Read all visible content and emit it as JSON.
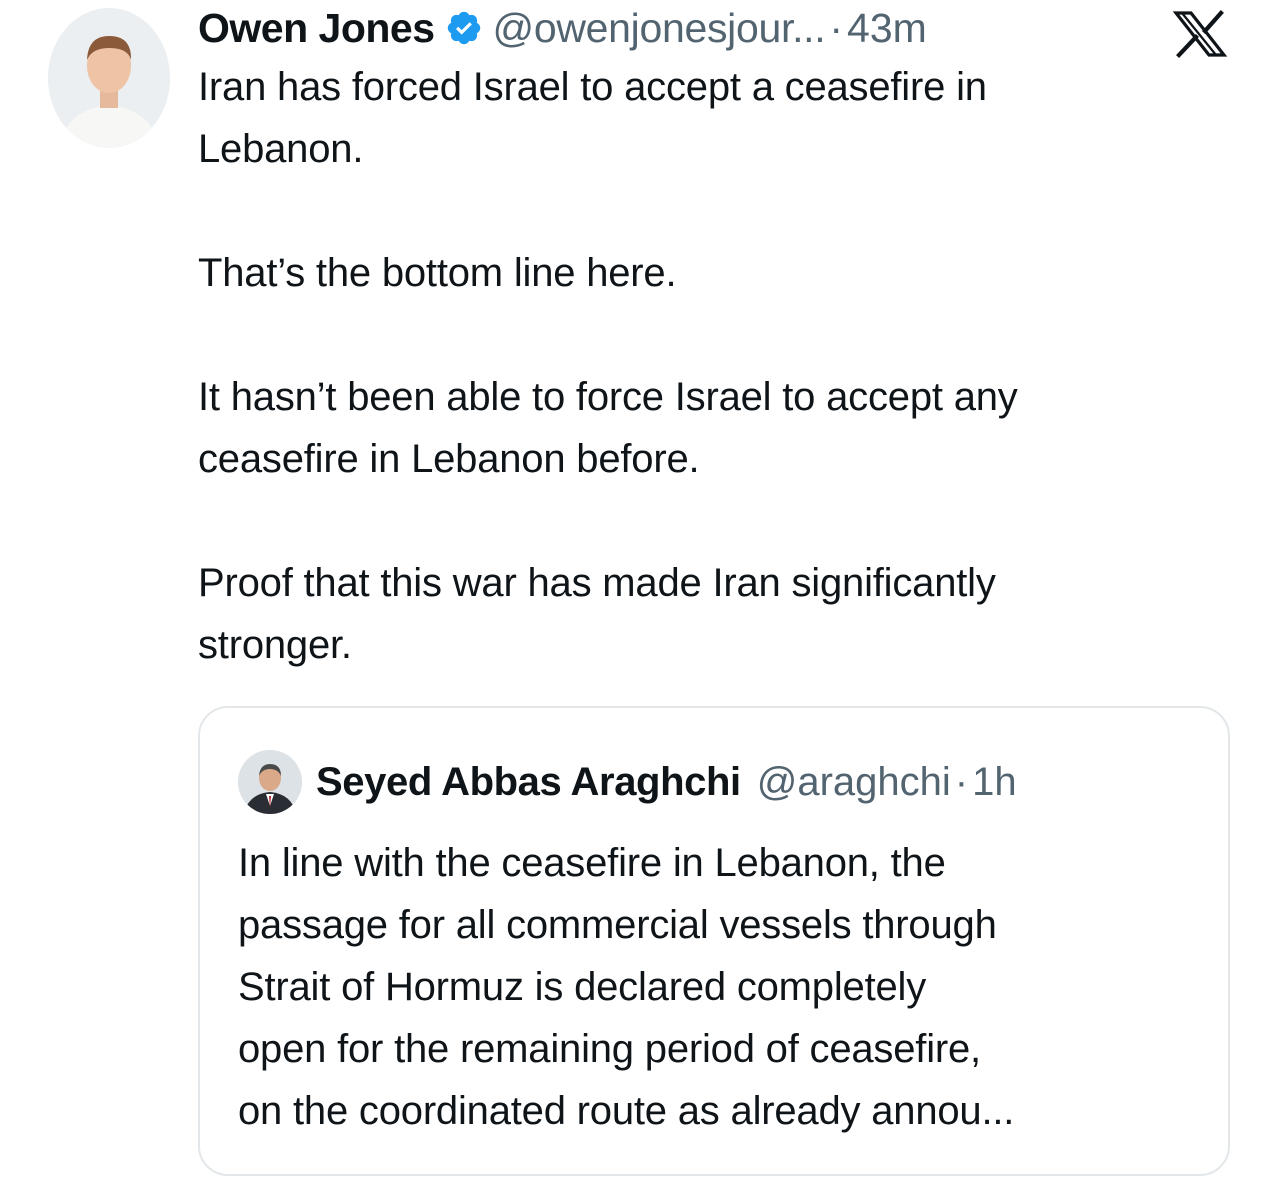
{
  "tweet": {
    "author_name": "Owen Jones",
    "author_handle": "@owenjonesjour...",
    "separator": "·",
    "time": "43m",
    "avatar_icon": "user-avatar-icon",
    "verified_icon": "verified-badge-icon",
    "platform_icon": "x-logo-icon",
    "paragraphs": [
      "Iran has forced Israel to accept a ceasefire in\nLebanon.",
      "That’s the bottom line here.",
      "It hasn’t been able to force Israel to accept any\nceasefire in Lebanon before.",
      "Proof that this war has made Iran significantly\nstronger."
    ]
  },
  "quoted_tweet": {
    "author_name": "Seyed Abbas Araghchi",
    "author_handle": "@araghchi",
    "separator": "·",
    "time": "1h",
    "avatar_icon": "user-avatar-icon",
    "text": "In line with the ceasefire in Lebanon, the\npassage for all commercial vessels through\nStrait of Hormuz is declared completely\nopen for the remaining period of ceasefire,\non the coordinated route as already annou..."
  },
  "colors": {
    "text_primary": "#0f1419",
    "text_secondary": "#536471",
    "verified_blue": "#1d9bf0",
    "border": "#e3e7ea"
  }
}
